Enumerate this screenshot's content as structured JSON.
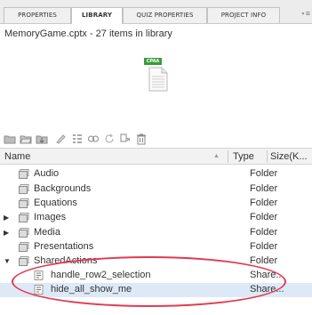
{
  "tabs": [
    {
      "label": "PROPERTIES"
    },
    {
      "label": "LIBRARY"
    },
    {
      "label": "QUIZ PROPERTIES"
    },
    {
      "label": "PROJECT INFO"
    }
  ],
  "tab_menu": "⋆≡",
  "library_summary": "MemoryGame.cptx - 27 items in library",
  "preview_badge": "CPAA",
  "columns": {
    "name": "Name",
    "sort": "▲",
    "type": "Type",
    "size": "Size(K..."
  },
  "rows": [
    {
      "name": "Audio",
      "type": "Folder",
      "expander": ""
    },
    {
      "name": "Backgrounds",
      "type": "Folder",
      "expander": ""
    },
    {
      "name": "Equations",
      "type": "Folder",
      "expander": ""
    },
    {
      "name": "Images",
      "type": "Folder",
      "expander": "▶"
    },
    {
      "name": "Media",
      "type": "Folder",
      "expander": "▶"
    },
    {
      "name": "Presentations",
      "type": "Folder",
      "expander": ""
    },
    {
      "name": "SharedActions",
      "type": "Folder",
      "expander": "▼"
    },
    {
      "name": "handle_row2_selection",
      "type": "Share..."
    },
    {
      "name": "hide_all_show_me",
      "type": "Share..."
    }
  ],
  "colors": {
    "selected_row": "#dde9f6",
    "highlight_ring": "#e23a50",
    "badge": "#3a9d3a"
  }
}
